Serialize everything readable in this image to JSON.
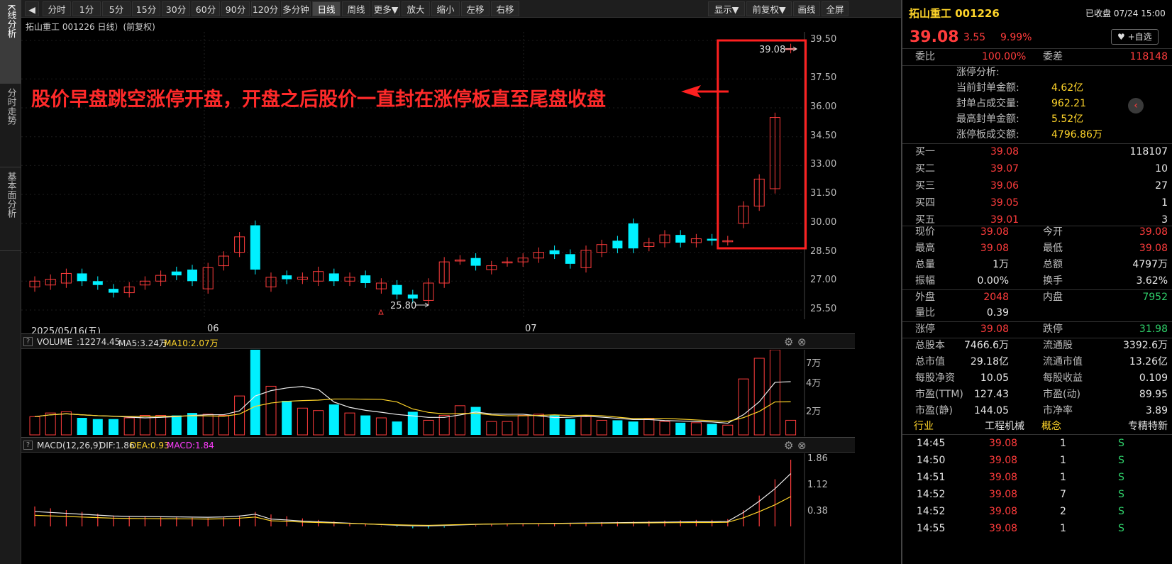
{
  "left_tabs": [
    "K线分析",
    "分时走势",
    "基本面分析"
  ],
  "toolbar": {
    "back": "◀",
    "buttons": [
      "分时",
      "1分",
      "5分",
      "15分",
      "30分",
      "60分",
      "90分",
      "120分",
      "多分钟",
      "日线",
      "周线",
      "更多▼",
      "放大",
      "缩小",
      "左移",
      "右移"
    ],
    "right_buttons": [
      "显示▼",
      "前复权▼",
      "画线",
      "全屏"
    ],
    "active": "日线"
  },
  "chart": {
    "title": "拓山重工 001226 日线）(前复权)",
    "annotation": "股价早盘跳空涨停开盘，开盘之后股价一直封在涨停板直至尾盘收盘",
    "price_axis": [
      "39.50",
      "37.50",
      "36.00",
      "34.50",
      "33.00",
      "31.50",
      "30.00",
      "28.50",
      "27.00",
      "25.50"
    ],
    "high_label": "39.08",
    "low_label": "25.80",
    "date_labels": [
      "2025/05/16(五)",
      "06",
      "07"
    ]
  },
  "chart_data": {
    "type": "candlestick",
    "ylim": [
      25.5,
      39.5
    ],
    "candles": [
      {
        "o": 26.7,
        "c": 27.0
      },
      {
        "o": 26.8,
        "c": 27.1
      },
      {
        "o": 26.9,
        "c": 27.4
      },
      {
        "o": 27.4,
        "c": 27.0
      },
      {
        "o": 27.0,
        "c": 26.8
      },
      {
        "o": 26.6,
        "c": 26.4
      },
      {
        "o": 26.4,
        "c": 26.7
      },
      {
        "o": 26.8,
        "c": 27.0
      },
      {
        "o": 27.0,
        "c": 27.3
      },
      {
        "o": 27.5,
        "c": 27.3
      },
      {
        "o": 27.6,
        "c": 27.0
      },
      {
        "o": 26.6,
        "c": 27.7
      },
      {
        "o": 27.8,
        "c": 28.3
      },
      {
        "o": 28.5,
        "c": 29.3
      },
      {
        "o": 29.9,
        "c": 27.6
      },
      {
        "o": 26.7,
        "c": 27.2
      },
      {
        "o": 27.3,
        "c": 27.1
      },
      {
        "o": 27.1,
        "c": 27.2
      },
      {
        "o": 27.0,
        "c": 27.5
      },
      {
        "o": 27.4,
        "c": 27.0
      },
      {
        "o": 27.0,
        "c": 27.2
      },
      {
        "o": 27.3,
        "c": 26.9
      },
      {
        "o": 26.6,
        "c": 26.9
      },
      {
        "o": 26.8,
        "c": 26.3
      },
      {
        "o": 26.3,
        "c": 26.1
      },
      {
        "o": 26.0,
        "c": 26.9
      },
      {
        "o": 26.9,
        "c": 28.0
      },
      {
        "o": 28.1,
        "c": 28.1
      },
      {
        "o": 28.2,
        "c": 27.8
      },
      {
        "o": 27.6,
        "c": 27.8
      },
      {
        "o": 28.0,
        "c": 28.0
      },
      {
        "o": 28.0,
        "c": 28.2
      },
      {
        "o": 28.2,
        "c": 28.5
      },
      {
        "o": 28.6,
        "c": 28.4
      },
      {
        "o": 28.4,
        "c": 27.9
      },
      {
        "o": 27.7,
        "c": 28.6
      },
      {
        "o": 28.5,
        "c": 28.9
      },
      {
        "o": 29.1,
        "c": 28.7
      },
      {
        "o": 30.0,
        "c": 28.7
      },
      {
        "o": 28.8,
        "c": 29.0
      },
      {
        "o": 29.0,
        "c": 29.4
      },
      {
        "o": 29.4,
        "c": 29.0
      },
      {
        "o": 29.0,
        "c": 29.2
      },
      {
        "o": 29.2,
        "c": 29.1
      },
      {
        "o": 29.1,
        "c": 29.1
      },
      {
        "o": 30.0,
        "c": 30.9
      },
      {
        "o": 30.9,
        "c": 32.3
      },
      {
        "o": 31.8,
        "c": 35.5
      },
      {
        "o": 39.08,
        "c": 39.08
      }
    ],
    "volume": {
      "label": "VOLUME",
      "value": ":12274.45",
      "ma5": "MA5:3.24万",
      "ma10": "MA10:2.07万",
      "axis": [
        "7万",
        "4万",
        "2万"
      ]
    },
    "macd": {
      "label": "MACD(12,26,9)",
      "dif": "DIF:1.86",
      "dea": "DEA:0.93",
      "macd": "MACD:1.84",
      "axis": [
        "1.86",
        "1.12",
        "0.38"
      ]
    }
  },
  "quote": {
    "name": "拓山重工 001226",
    "status": "已收盘 07/24 15:00",
    "price": "39.08",
    "change": "3.55",
    "pct": "9.99%",
    "watch": "♥ +自选",
    "weibi_label": "委比",
    "weibi": "100.00%",
    "weicha_label": "委差",
    "weicha": "118148",
    "limit_title": "涨停分析:",
    "limit_rows": [
      [
        "当前封单金额:",
        "4.62亿"
      ],
      [
        "封单占成交量:",
        "962.21"
      ],
      [
        "最高封单金额:",
        "5.52亿"
      ],
      [
        "涨停板成交额:",
        "4796.86万"
      ]
    ],
    "bids": [
      [
        "买一",
        "39.08",
        "118107"
      ],
      [
        "买二",
        "39.07",
        "10"
      ],
      [
        "买三",
        "39.06",
        "27"
      ],
      [
        "买四",
        "39.05",
        "1"
      ],
      [
        "买五",
        "39.01",
        "3"
      ]
    ],
    "stats": [
      [
        "现价",
        "39.08",
        "今开",
        "39.08"
      ],
      [
        "最高",
        "39.08",
        "最低",
        "39.08"
      ],
      [
        "总量",
        "1万",
        "总额",
        "4797万"
      ],
      [
        "振幅",
        "0.00%",
        "换手",
        "3.62%"
      ],
      [
        "外盘",
        "2048",
        "内盘",
        "7952"
      ],
      [
        "量比",
        "0.39",
        "",
        ""
      ],
      [
        "涨停",
        "39.08",
        "跌停",
        "31.98"
      ],
      [
        "总股本",
        "7466.6万",
        "流通股",
        "3392.6万"
      ],
      [
        "总市值",
        "29.18亿",
        "流通市值",
        "13.26亿"
      ],
      [
        "每股净资",
        "10.05",
        "每股收益",
        "0.109"
      ],
      [
        "市盈(TTM)",
        "127.43",
        "市盈(动)",
        "89.95"
      ],
      [
        "市盈(静)",
        "144.05",
        "市净率",
        "3.89"
      ]
    ],
    "industry": [
      "行业",
      "工程机械",
      "概念",
      "专精特新"
    ],
    "ticks": [
      [
        "14:45",
        "39.08",
        "1",
        "S"
      ],
      [
        "14:50",
        "39.08",
        "1",
        "S"
      ],
      [
        "14:51",
        "39.08",
        "1",
        "S"
      ],
      [
        "14:52",
        "39.08",
        "7",
        "S"
      ],
      [
        "14:52",
        "39.08",
        "2",
        "S"
      ],
      [
        "14:55",
        "39.08",
        "1",
        "S"
      ]
    ]
  }
}
